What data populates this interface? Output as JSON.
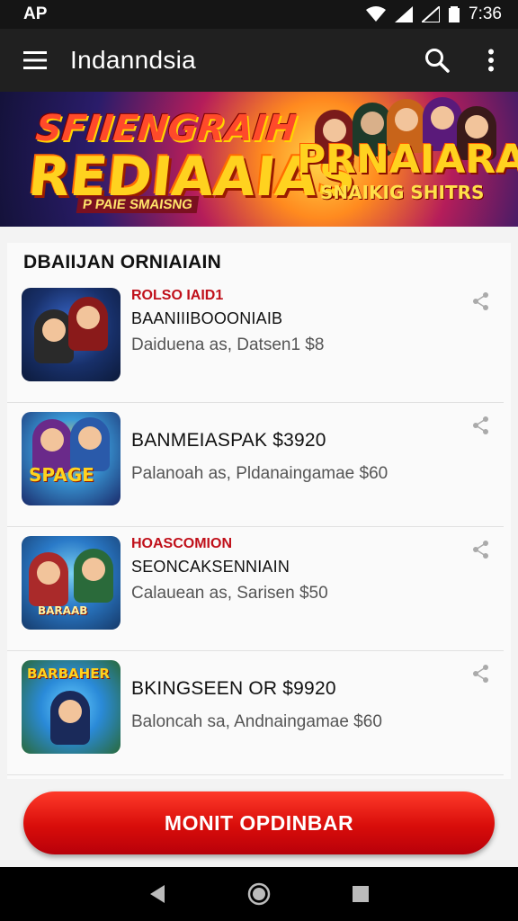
{
  "status_bar": {
    "carrier": "AP",
    "time": "7:36"
  },
  "app_bar": {
    "title": "Indanndsia",
    "icons": [
      "hamburger-menu-icon",
      "search-icon",
      "more-vert-icon"
    ]
  },
  "banner": {
    "title_line1": "SFIIENGRAIH",
    "title_line2": "REDIAAIAS",
    "tagline": "P PAIE SMAISNG",
    "right_title": "PRNAIARA",
    "right_subtitle": "SNAIKIG SHITRS"
  },
  "section": {
    "title": "DBAIIJAN ORNIAIAIN"
  },
  "items": [
    {
      "tag": "ROLSO IAID1",
      "name": "BAANIIIBOOONIAIB",
      "subtitle": "Daiduena as, Datsen1 $8",
      "thumb_label": ""
    },
    {
      "tag": "",
      "name": "BANMEIASPAK $3920",
      "subtitle": "Palanoah as, Pldanaingamae $60",
      "thumb_label": "SPAGE"
    },
    {
      "tag": "HOASCOMION",
      "name": "SEONCAKSENNIAIN",
      "subtitle": "Calauean as, Sarisen $50",
      "thumb_label": "BARAAB"
    },
    {
      "tag": "",
      "name": "BKINGSEEN OR $9920",
      "subtitle": "Baloncah sa, Andnaingamae $60",
      "thumb_label": "BARBAHER"
    }
  ],
  "cta_button": {
    "label": "MONIT OPDINBAR"
  },
  "nav_bar": {
    "icons": [
      "back-icon",
      "home-icon",
      "recents-icon"
    ]
  },
  "colors": {
    "accent_red": "#d80d0a",
    "tag_red": "#c0101a",
    "app_bar": "#202020"
  }
}
